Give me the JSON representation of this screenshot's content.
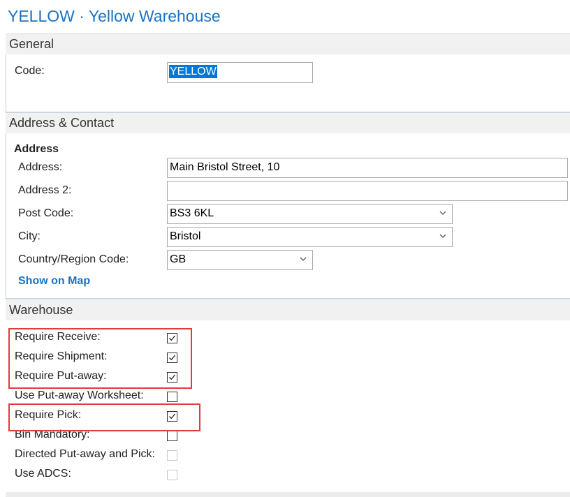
{
  "page": {
    "title": "YELLOW · Yellow Warehouse"
  },
  "general": {
    "header": "General",
    "code_label": "Code:",
    "code_value": "YELLOW"
  },
  "address_contact": {
    "header": "Address & Contact",
    "group_title": "Address",
    "address_label": "Address:",
    "address_value": "Main Bristol Street, 10",
    "address2_label": "Address 2:",
    "address2_value": "",
    "post_code_label": "Post Code:",
    "post_code_value": "BS3 6KL",
    "city_label": "City:",
    "city_value": "Bristol",
    "country_label": "Country/Region Code:",
    "country_value": "GB",
    "show_on_map": "Show on Map"
  },
  "warehouse": {
    "header": "Warehouse",
    "fields": [
      {
        "label": "Require Receive:",
        "checked": true,
        "enabled": true
      },
      {
        "label": "Require Shipment:",
        "checked": true,
        "enabled": true
      },
      {
        "label": "Require Put-away:",
        "checked": true,
        "enabled": true
      },
      {
        "label": "Use Put-away Worksheet:",
        "checked": false,
        "enabled": true
      },
      {
        "label": "Require Pick:",
        "checked": true,
        "enabled": true
      },
      {
        "label": "Bin Mandatory:",
        "checked": false,
        "enabled": true
      },
      {
        "label": "Directed Put-away and Pick:",
        "checked": false,
        "enabled": false
      },
      {
        "label": "Use ADCS:",
        "checked": false,
        "enabled": false
      }
    ]
  },
  "colors": {
    "accent": "#1a73c4",
    "highlight_box": "#e23b3b",
    "selection": "#0078d7"
  }
}
